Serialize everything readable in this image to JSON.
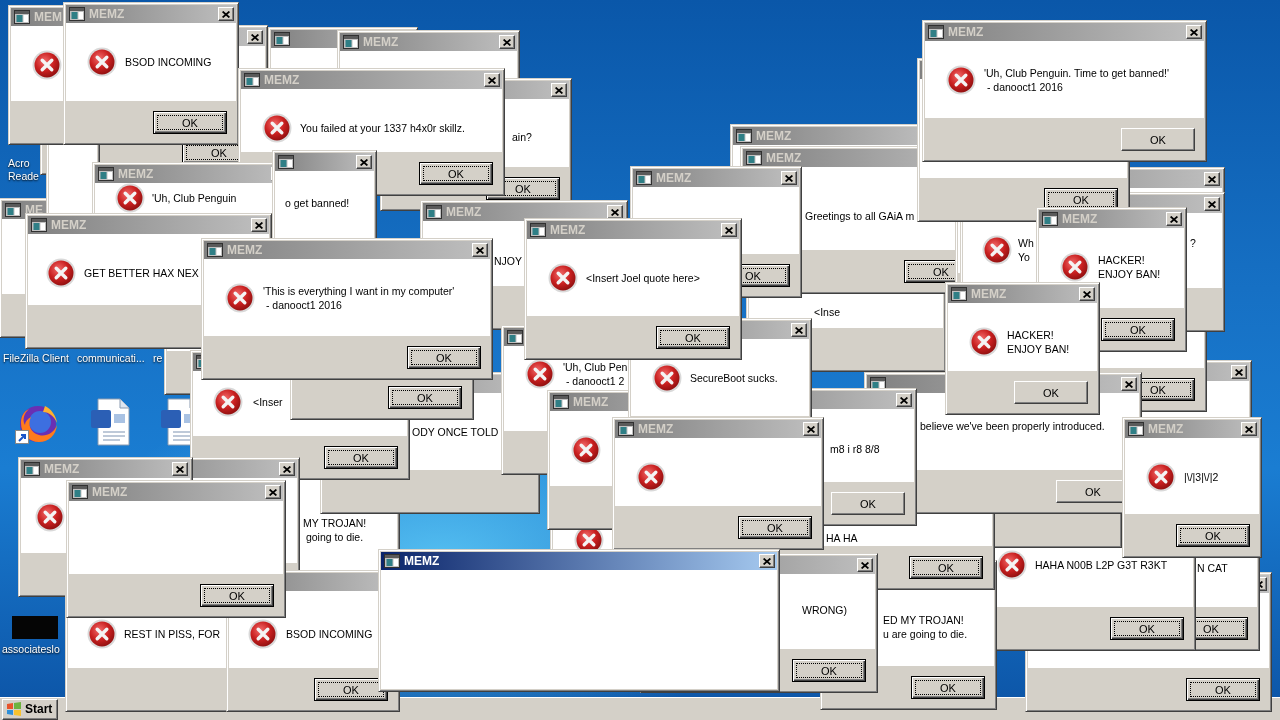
{
  "desktop": {
    "labels": [
      {
        "lines": [
          "Acro",
          "Reade"
        ]
      },
      {
        "lines": [
          "FileZilla Client"
        ]
      },
      {
        "lines": [
          "communicati..."
        ]
      },
      {
        "lines": [
          "re"
        ]
      },
      {
        "lines": [
          "associateslo"
        ]
      }
    ]
  },
  "windows": [
    {
      "kind": "error",
      "title": "MEM"
    },
    {
      "kind": "blank",
      "button": {
        "label": "OK",
        "focused": true
      }
    },
    {
      "kind": "error",
      "title": "MEMZ",
      "lines": [
        "BSOD INCOMING"
      ],
      "button": {
        "label": "OK",
        "focused": true
      }
    },
    {
      "kind": "error",
      "title": "MEMZ",
      "lines": [
        "'Uh, Club Penguin. Time to get banned!'",
        " - danooct1 2016"
      ],
      "button": {
        "label": "OK",
        "focused": false
      }
    },
    {
      "kind": "blank"
    },
    {
      "kind": "blank",
      "title": "MEMZ"
    },
    {
      "kind": "error",
      "title": "MEMZ",
      "lines": [
        "You failed at your 1337 h4x0r skillz."
      ],
      "button": {
        "label": "OK",
        "focused": true
      }
    },
    {
      "kind": "blank",
      "lines": [
        "ain?"
      ],
      "button": {
        "label": "OK",
        "focused": true
      }
    },
    {
      "kind": "blank",
      "button": {
        "label": "OK",
        "focused": true
      }
    },
    {
      "kind": "blank"
    },
    {
      "kind": "blank",
      "title": "MEMZ"
    },
    {
      "kind": "error",
      "title": "MEMZ",
      "lines": [
        "'Uh, Club Penguin"
      ]
    },
    {
      "kind": "blank",
      "lines": [
        "o get banned!"
      ]
    },
    {
      "kind": "blank",
      "title": "MEMZ",
      "button": {
        "label": "OK",
        "focused": true
      }
    },
    {
      "kind": "blank",
      "title": "MEMZ",
      "lines": [
        "Greetings to all GAiA m"
      ],
      "button": {
        "label": "OK",
        "focused": true
      }
    },
    {
      "kind": "blank"
    },
    {
      "kind": "blank",
      "title": "ME"
    },
    {
      "kind": "error",
      "title": "MEMZ",
      "lines": [
        "GET BETTER HAX NEX"
      ]
    },
    {
      "kind": "blank",
      "title": "MEMZ",
      "lines": [
        "NJOY"
      ]
    },
    {
      "kind": "error",
      "lines": [
        "Wh",
        "Yo"
      ],
      "fragments": [
        "?"
      ]
    },
    {
      "kind": "error",
      "title": "MEMZ",
      "lines": [
        "HACKER!",
        "ENJOY BAN!"
      ],
      "button": {
        "label": "OK",
        "focused": true
      }
    },
    {
      "kind": "error",
      "title": "MEMZ",
      "lines": [
        "'This is everything I want in my computer'",
        " - danooct1 2016"
      ],
      "button": {
        "label": "OK",
        "focused": true
      }
    },
    {
      "kind": "error",
      "title": "MEMZ",
      "lines": [
        "<Insert Joel quote here>"
      ],
      "button": {
        "label": "OK",
        "focused": true
      }
    },
    {
      "kind": "blank",
      "lines": [
        "<Inse"
      ]
    },
    {
      "kind": "error",
      "title": "MEMZ",
      "lines": [
        "HACKER!",
        "ENJOY BAN!"
      ],
      "button": {
        "label": "OK",
        "focused": false
      }
    },
    {
      "kind": "blank",
      "button": {
        "label": "OK",
        "focused": true
      }
    },
    {
      "kind": "blank"
    },
    {
      "kind": "error",
      "lines": [
        "SecureBoot sucks."
      ]
    },
    {
      "kind": "blank",
      "button": {
        "label": "OK",
        "focused": true
      }
    },
    {
      "kind": "error",
      "lines": [
        "'Uh, Club Pen",
        " - danooct1 2"
      ]
    },
    {
      "kind": "error",
      "lines": [
        "<Inser"
      ],
      "button": {
        "label": "OK",
        "focused": true
      }
    },
    {
      "kind": "blank",
      "lines": [
        "ODY ONCE TOLD"
      ]
    },
    {
      "kind": "blank",
      "lines": [
        "believe we've been properly introduced."
      ],
      "button": {
        "label": "OK",
        "focused": false
      }
    },
    {
      "kind": "blank"
    },
    {
      "kind": "error",
      "title": "MEMZ"
    },
    {
      "kind": "error",
      "title": "MEMZ",
      "button": {
        "label": "OK",
        "focused": true
      }
    },
    {
      "kind": "blank",
      "lines": [
        "m8 i r8 8/8"
      ],
      "button": {
        "label": "OK",
        "focused": false
      }
    },
    {
      "kind": "blank"
    },
    {
      "kind": "error",
      "title": "MEMZ",
      "lines": [
        "|\\/|3|\\/|2"
      ],
      "button": {
        "label": "OK",
        "focused": true
      }
    },
    {
      "kind": "error",
      "title": "MEMZ"
    },
    {
      "kind": "blank"
    },
    {
      "kind": "blank",
      "lines": [
        "MY TROJAN!",
        " going to die."
      ]
    },
    {
      "kind": "blank",
      "lines": [
        "HA HA"
      ],
      "button": {
        "label": "OK",
        "focused": true
      }
    },
    {
      "kind": "blank",
      "title": "MEMZ",
      "button": {
        "label": "OK",
        "focused": true
      }
    },
    {
      "kind": "error"
    },
    {
      "kind": "error",
      "lines": [
        "HAHA N00B L2P G3T R3KT"
      ],
      "button": {
        "label": "OK",
        "focused": true
      }
    },
    {
      "kind": "blank",
      "lines": [
        "N CAT"
      ],
      "button": {
        "label": "OK",
        "focused": true
      }
    },
    {
      "kind": "error",
      "lines": [
        "BSOD INCOMING"
      ],
      "button": {
        "label": "OK",
        "focused": true
      }
    },
    {
      "kind": "blank",
      "lines": [
        "WRONG)"
      ],
      "button": {
        "label": "OK",
        "focused": true
      }
    },
    {
      "kind": "blank",
      "lines": [
        "ED MY TROJAN!",
        "u are going to die."
      ],
      "button": {
        "label": "OK",
        "focused": true
      }
    },
    {
      "kind": "blank",
      "button": {
        "label": "OK",
        "focused": true
      }
    },
    {
      "kind": "error",
      "lines": [
        "REST IN PISS, FOR"
      ]
    }
  ],
  "active_window": {
    "title": "MEMZ"
  },
  "taskbar": {
    "start_label": "Start"
  }
}
